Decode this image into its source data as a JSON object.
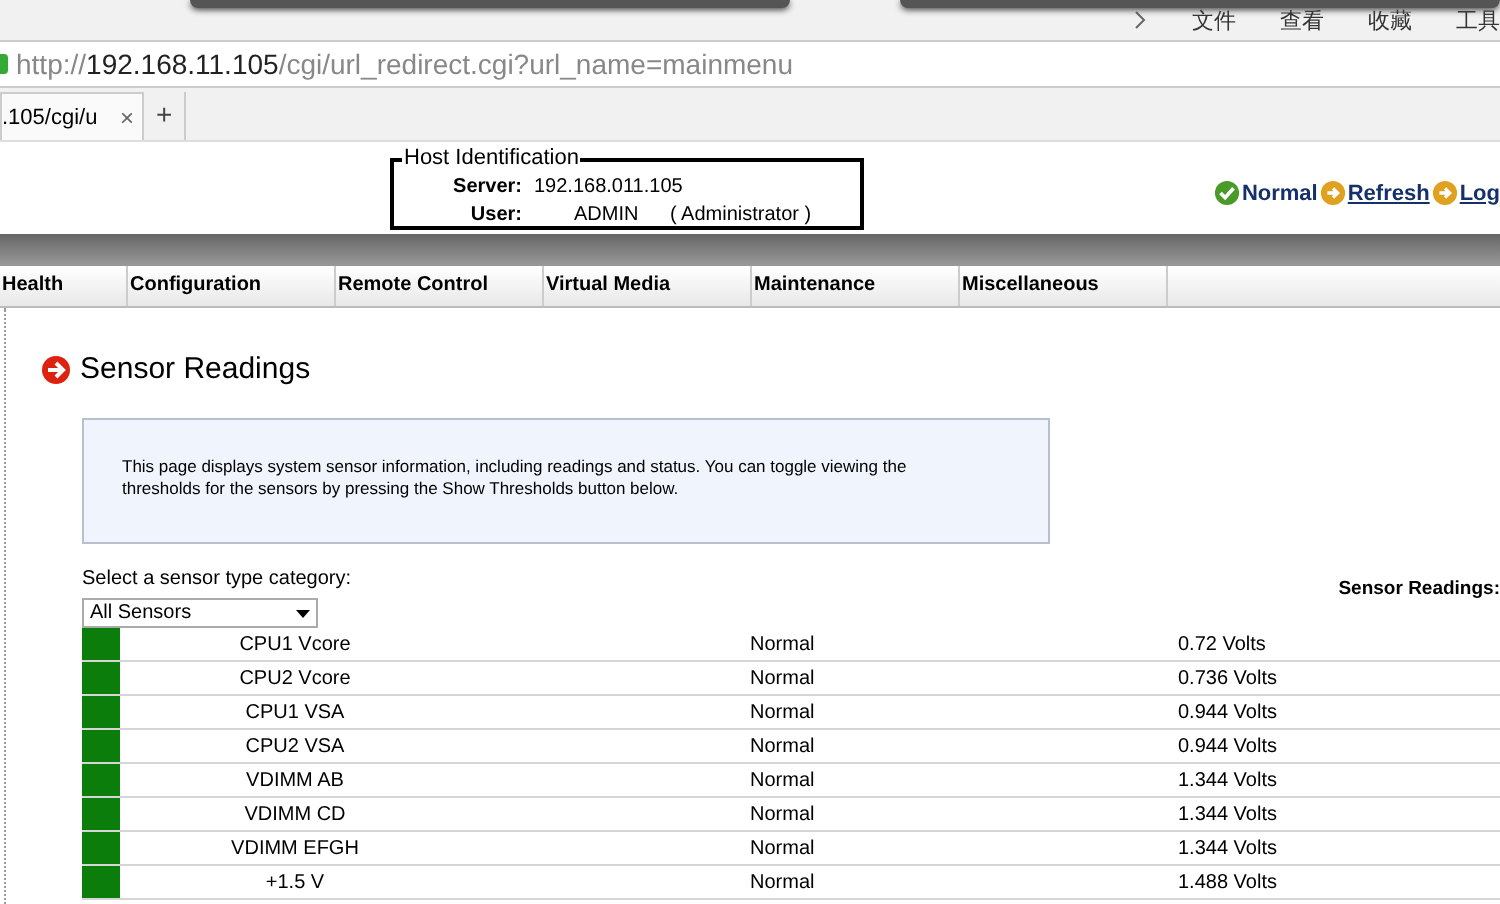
{
  "browser": {
    "menu": [
      "文件",
      "查看",
      "收藏",
      "工具"
    ],
    "address": {
      "host_prefix": "http://",
      "host": "192.168.11.105",
      "path": "/cgi/url_redirect.cgi?url_name=mainmenu"
    },
    "tab": {
      "label": ".105/cgi/u",
      "close": "×"
    },
    "new_tab": "+"
  },
  "host_identification": {
    "legend": "Host Identification",
    "server_label": "Server:",
    "server": "192.168.011.105",
    "user_label": "User:",
    "user": "ADMIN",
    "role": "( Administrator )"
  },
  "status_links": [
    {
      "kind": "status",
      "label": "Normal"
    },
    {
      "kind": "link",
      "label": "Refresh"
    },
    {
      "kind": "link",
      "label": "Log"
    }
  ],
  "nav_tabs": [
    {
      "label": "Health",
      "selected": false
    },
    {
      "label": "Configuration",
      "selected": false
    },
    {
      "label": "Remote Control",
      "selected": false
    },
    {
      "label": "Virtual Media",
      "selected": false
    },
    {
      "label": "Maintenance",
      "selected": false
    },
    {
      "label": "Miscellaneous",
      "selected": false
    }
  ],
  "page_title": "Sensor Readings",
  "info_text": "This page displays system sensor information, including readings and status. You can toggle viewing the thresholds for the sensors by pressing the Show Thresholds button below.",
  "category_label": "Select a sensor type category:",
  "category_select": {
    "value": "All Sensors"
  },
  "sensor_count_label": "Sensor Readings:",
  "sensors": [
    {
      "color": "#0a7d0a",
      "name": "CPU1 Vcore",
      "status": "Normal",
      "reading": "0.72 Volts"
    },
    {
      "color": "#0a7d0a",
      "name": "CPU2 Vcore",
      "status": "Normal",
      "reading": "0.736 Volts"
    },
    {
      "color": "#0a7d0a",
      "name": "CPU1 VSA",
      "status": "Normal",
      "reading": "0.944 Volts"
    },
    {
      "color": "#0a7d0a",
      "name": "CPU2 VSA",
      "status": "Normal",
      "reading": "0.944 Volts"
    },
    {
      "color": "#0a7d0a",
      "name": "VDIMM AB",
      "status": "Normal",
      "reading": "1.344 Volts"
    },
    {
      "color": "#0a7d0a",
      "name": "VDIMM CD",
      "status": "Normal",
      "reading": "1.344 Volts"
    },
    {
      "color": "#0a7d0a",
      "name": "VDIMM EFGH",
      "status": "Normal",
      "reading": "1.344 Volts"
    },
    {
      "color": "#0a7d0a",
      "name": "+1.5 V",
      "status": "Normal",
      "reading": "1.488 Volts"
    }
  ]
}
